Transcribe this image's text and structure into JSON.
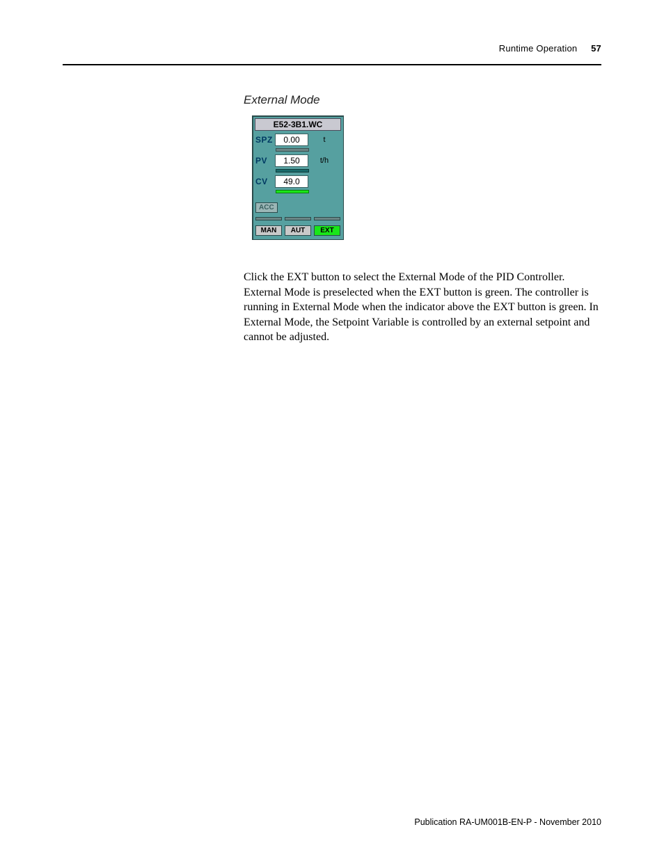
{
  "header": {
    "running_title": "Runtime Operation",
    "page_number": "57"
  },
  "section": {
    "title": "External Mode"
  },
  "faceplate": {
    "title": "E52-3B1.WC",
    "rows": {
      "spz": {
        "label": "SPZ",
        "value": "0.00",
        "unit": "t"
      },
      "pv": {
        "label": "PV",
        "value": "1.50",
        "unit": "t/h"
      },
      "cv": {
        "label": "CV",
        "value": "49.0",
        "unit": ""
      }
    },
    "acc_label": "ACC",
    "modes": {
      "man": "MAN",
      "aut": "AUT",
      "ext": "EXT"
    }
  },
  "paragraph": "Click the EXT button to select the External Mode of the PID Controller. External Mode is preselected when the EXT button is green. The controller is running in External Mode when the indicator above the EXT button is green. In External Mode, the Setpoint Variable is controlled by an external setpoint and cannot be adjusted.",
  "footer": "Publication RA-UM001B-EN-P - November 2010"
}
